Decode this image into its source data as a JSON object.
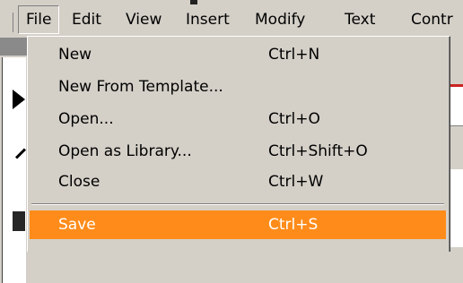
{
  "menubar": {
    "items": [
      {
        "label": "File",
        "active": true
      },
      {
        "label": "Edit"
      },
      {
        "label": "View"
      },
      {
        "label": "Insert"
      },
      {
        "label": "Modify"
      },
      {
        "label": "Text"
      },
      {
        "label": "Contr"
      }
    ]
  },
  "file_menu": {
    "items": [
      {
        "label": "New",
        "shortcut": "Ctrl+N"
      },
      {
        "label": "New From Template...",
        "shortcut": ""
      },
      {
        "label": "Open...",
        "shortcut": "Ctrl+O"
      },
      {
        "label": "Open as Library...",
        "shortcut": "Ctrl+Shift+O"
      },
      {
        "label": "Close",
        "shortcut": "Ctrl+W"
      },
      {
        "label": "Save",
        "shortcut": "Ctrl+S",
        "highlighted": true
      }
    ]
  },
  "colors": {
    "menu_bg": "#d4d0c8",
    "highlight": "#ff8c1a",
    "highlight_text": "#ffffff"
  }
}
